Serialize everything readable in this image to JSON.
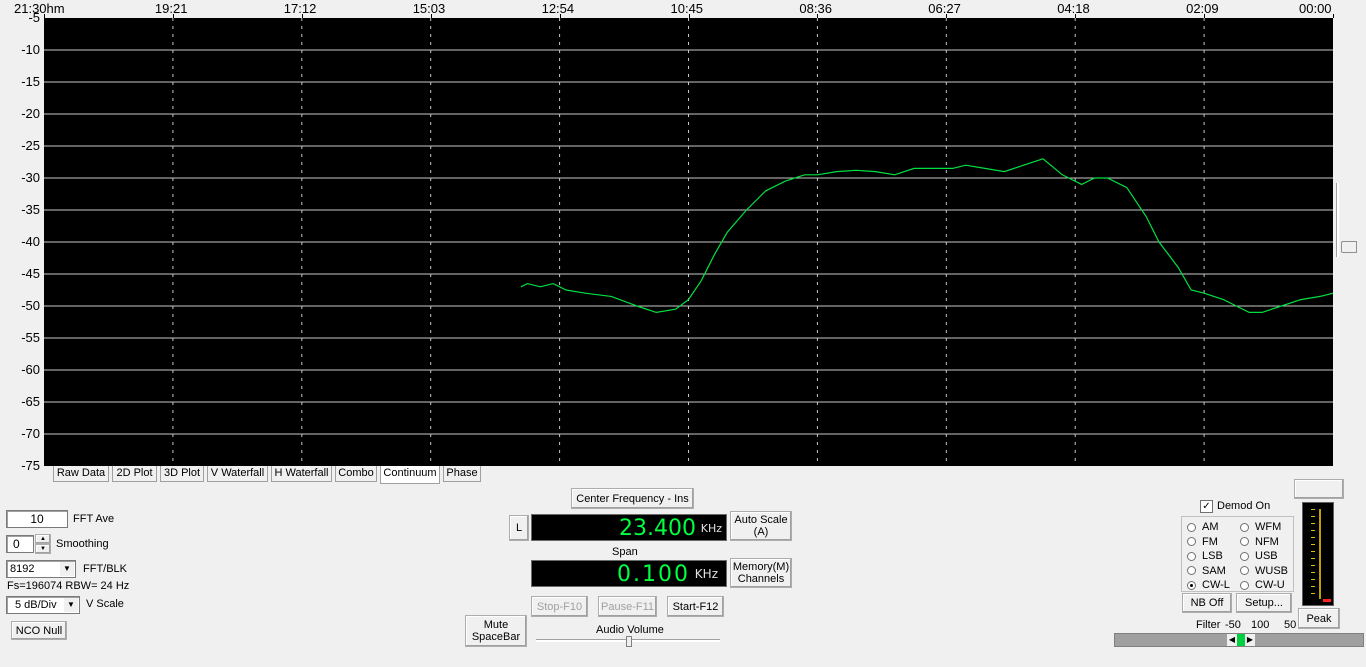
{
  "plot": {
    "x_labels": [
      "21:30hm",
      "19:21",
      "17:12",
      "15:03",
      "12:54",
      "10:45",
      "08:36",
      "06:27",
      "04:18",
      "02:09",
      "00:00"
    ],
    "y_labels": [
      "-5",
      "-10",
      "-15",
      "-20",
      "-25",
      "-30",
      "-35",
      "-40",
      "-45",
      "-50",
      "-55",
      "-60",
      "-65",
      "-70",
      "-75"
    ],
    "colors": {
      "background": "#000000",
      "grid": "#c8c8c8",
      "trace": "#00e040"
    }
  },
  "chart_data": {
    "type": "line",
    "ylim": [
      -75,
      -5
    ],
    "xlim": [
      0,
      1
    ],
    "grid": true,
    "series": [
      {
        "x": [
          0.37,
          0.375,
          0.385,
          0.395,
          0.405,
          0.42,
          0.44,
          0.46,
          0.475,
          0.49,
          0.5,
          0.51,
          0.52,
          0.53,
          0.545,
          0.56,
          0.575,
          0.59,
          0.6,
          0.615,
          0.63,
          0.645,
          0.66,
          0.675,
          0.69,
          0.705,
          0.715,
          0.73,
          0.745,
          0.76,
          0.775,
          0.79,
          0.805,
          0.815,
          0.825,
          0.84,
          0.855,
          0.865,
          0.88,
          0.89,
          0.9,
          0.915,
          0.925,
          0.935,
          0.945,
          0.96,
          0.975,
          0.99,
          1.0
        ],
        "y": [
          -47,
          -46.5,
          -47,
          -46.5,
          -47.5,
          -48,
          -48.5,
          -50,
          -51,
          -50.5,
          -49,
          -46,
          -42,
          -38.5,
          -35,
          -32,
          -30.5,
          -29.5,
          -29.5,
          -29,
          -28.8,
          -29,
          -29.5,
          -28.5,
          -28.5,
          -28.5,
          -28,
          -28.5,
          -29,
          -28,
          -27,
          -29.5,
          -31,
          -30,
          -30,
          -31.5,
          -36,
          -40,
          -44,
          -47.5,
          -48,
          -49,
          -50,
          -51,
          -51,
          -50,
          -49,
          -48.5,
          -48
        ]
      }
    ]
  },
  "tabs": [
    {
      "label": "Raw Data"
    },
    {
      "label": "2D Plot"
    },
    {
      "label": "3D Plot"
    },
    {
      "label": "V Waterfall"
    },
    {
      "label": "H Waterfall"
    },
    {
      "label": "Combo"
    },
    {
      "label": "Continuum"
    },
    {
      "label": "Phase"
    }
  ],
  "active_tab": "Continuum",
  "controls": {
    "fft_ave_value": "10",
    "fft_ave_label": "FFT Ave",
    "smoothing_value": "0",
    "smoothing_label": "Smoothing",
    "fft_blk_value": "8192",
    "fft_blk_label": "FFT/BLK",
    "fs_info": "Fs=196074 RBW= 24 Hz",
    "vscale_value": "5 dB/Div",
    "vscale_label": "V Scale",
    "nco_null": "NCO Null",
    "mute": "Mute SpaceBar"
  },
  "center": {
    "button": "Center Frequency - Ins",
    "l_button": "L",
    "frequency": "23.400",
    "freq_unit": "KHz",
    "auto_scale": "Auto Scale (A)",
    "span_label": "Span",
    "span": "0.100",
    "span_unit": "KHz",
    "memory": "Memory(M) Channels",
    "stop": "Stop-F10",
    "pause": "Pause-F11",
    "start": "Start-F12",
    "audio_volume": "Audio Volume"
  },
  "demod": {
    "demod_on_label": "Demod On",
    "demod_on_checked": true,
    "modes": [
      {
        "label": "AM",
        "selected": false
      },
      {
        "label": "WFM",
        "selected": false
      },
      {
        "label": "FM",
        "selected": false
      },
      {
        "label": "NFM",
        "selected": false
      },
      {
        "label": "LSB",
        "selected": false
      },
      {
        "label": "USB",
        "selected": false
      },
      {
        "label": "SAM",
        "selected": false
      },
      {
        "label": "WUSB",
        "selected": false
      },
      {
        "label": "CW-L",
        "selected": true
      },
      {
        "label": "CW-U",
        "selected": false
      }
    ],
    "nb_off": "NB Off",
    "setup": "Setup...",
    "peak": "Peak",
    "filter_label": "Filter",
    "filter_min": "-50",
    "filter_center": "100",
    "filter_max": "50"
  }
}
